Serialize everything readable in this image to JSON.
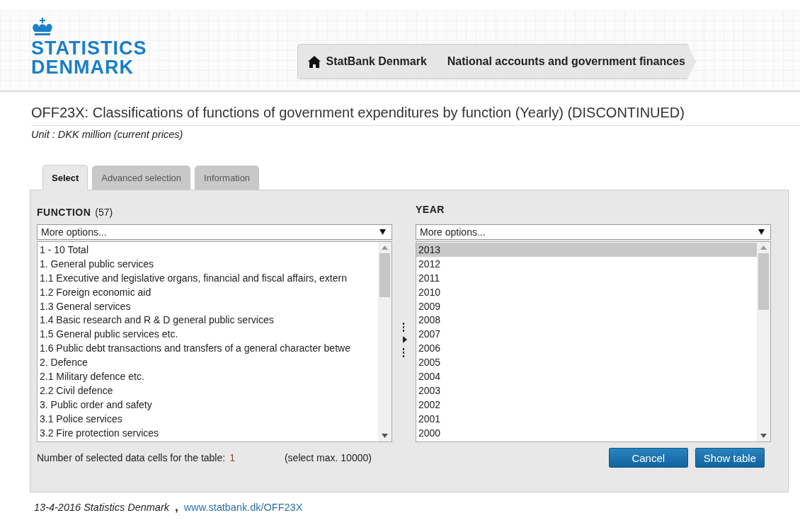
{
  "logo": {
    "line1": "STATISTICS",
    "line2": "DENMARK"
  },
  "breadcrumb": [
    {
      "label": "StatBank Denmark",
      "kind": "home"
    },
    {
      "label": "National accounts and government finances",
      "kind": "page"
    }
  ],
  "title": "OFF23X: Classifications of functions of government expenditures by function (Yearly) (DISCONTINUED)",
  "unit": "Unit : DKK million (current prices)",
  "tabs": [
    {
      "label": "Select",
      "selected": true
    },
    {
      "label": "Advanced selection",
      "selected": false
    },
    {
      "label": "Information",
      "selected": false
    }
  ],
  "variables": [
    {
      "name": "FUNCTION",
      "count": "(57)",
      "dropdown": "More options...",
      "items": [
        {
          "label": "1 - 10 Total",
          "selected": false
        },
        {
          "label": "1. General public services",
          "selected": false
        },
        {
          "label": "1.1 Executive and legislative organs, financial and fiscal affairs, extern",
          "selected": false
        },
        {
          "label": "1.2 Foreign economic aid",
          "selected": false
        },
        {
          "label": "1.3 General services",
          "selected": false
        },
        {
          "label": "1.4 Basic research and R & D general public services",
          "selected": false
        },
        {
          "label": "1.5 General public services etc.",
          "selected": false
        },
        {
          "label": "1.6 Public debt transactions and transfers of a general character betwe",
          "selected": false
        },
        {
          "label": "2. Defence",
          "selected": false
        },
        {
          "label": "2.1 Military defence etc.",
          "selected": false
        },
        {
          "label": "2.2 Civil defence",
          "selected": false
        },
        {
          "label": "3. Public order and safety",
          "selected": false
        },
        {
          "label": "3.1 Police services",
          "selected": false
        },
        {
          "label": "3.2 Fire protection services",
          "selected": false
        }
      ]
    },
    {
      "name": "YEAR",
      "dropdown": "More options...",
      "items": [
        {
          "label": "2013",
          "selected": true
        },
        {
          "label": "2012",
          "selected": false
        },
        {
          "label": "2011",
          "selected": false
        },
        {
          "label": "2010",
          "selected": false
        },
        {
          "label": "2009",
          "selected": false
        },
        {
          "label": "2008",
          "selected": false
        },
        {
          "label": "2007",
          "selected": false
        },
        {
          "label": "2006",
          "selected": false
        },
        {
          "label": "2005",
          "selected": false
        },
        {
          "label": "2004",
          "selected": false
        },
        {
          "label": "2003",
          "selected": false
        },
        {
          "label": "2002",
          "selected": false
        },
        {
          "label": "2001",
          "selected": false
        },
        {
          "label": "2000",
          "selected": false
        }
      ]
    }
  ],
  "selected_cells": {
    "label": "Number of selected data cells for the table:",
    "value": "1",
    "max": "(select max. 10000)"
  },
  "buttons": [
    "Cancel",
    "Show table"
  ],
  "footer": {
    "text": "13-4-2016 Statistics Denmark",
    "separator": ",",
    "link": "www.statbank.dk/OFF23X"
  }
}
